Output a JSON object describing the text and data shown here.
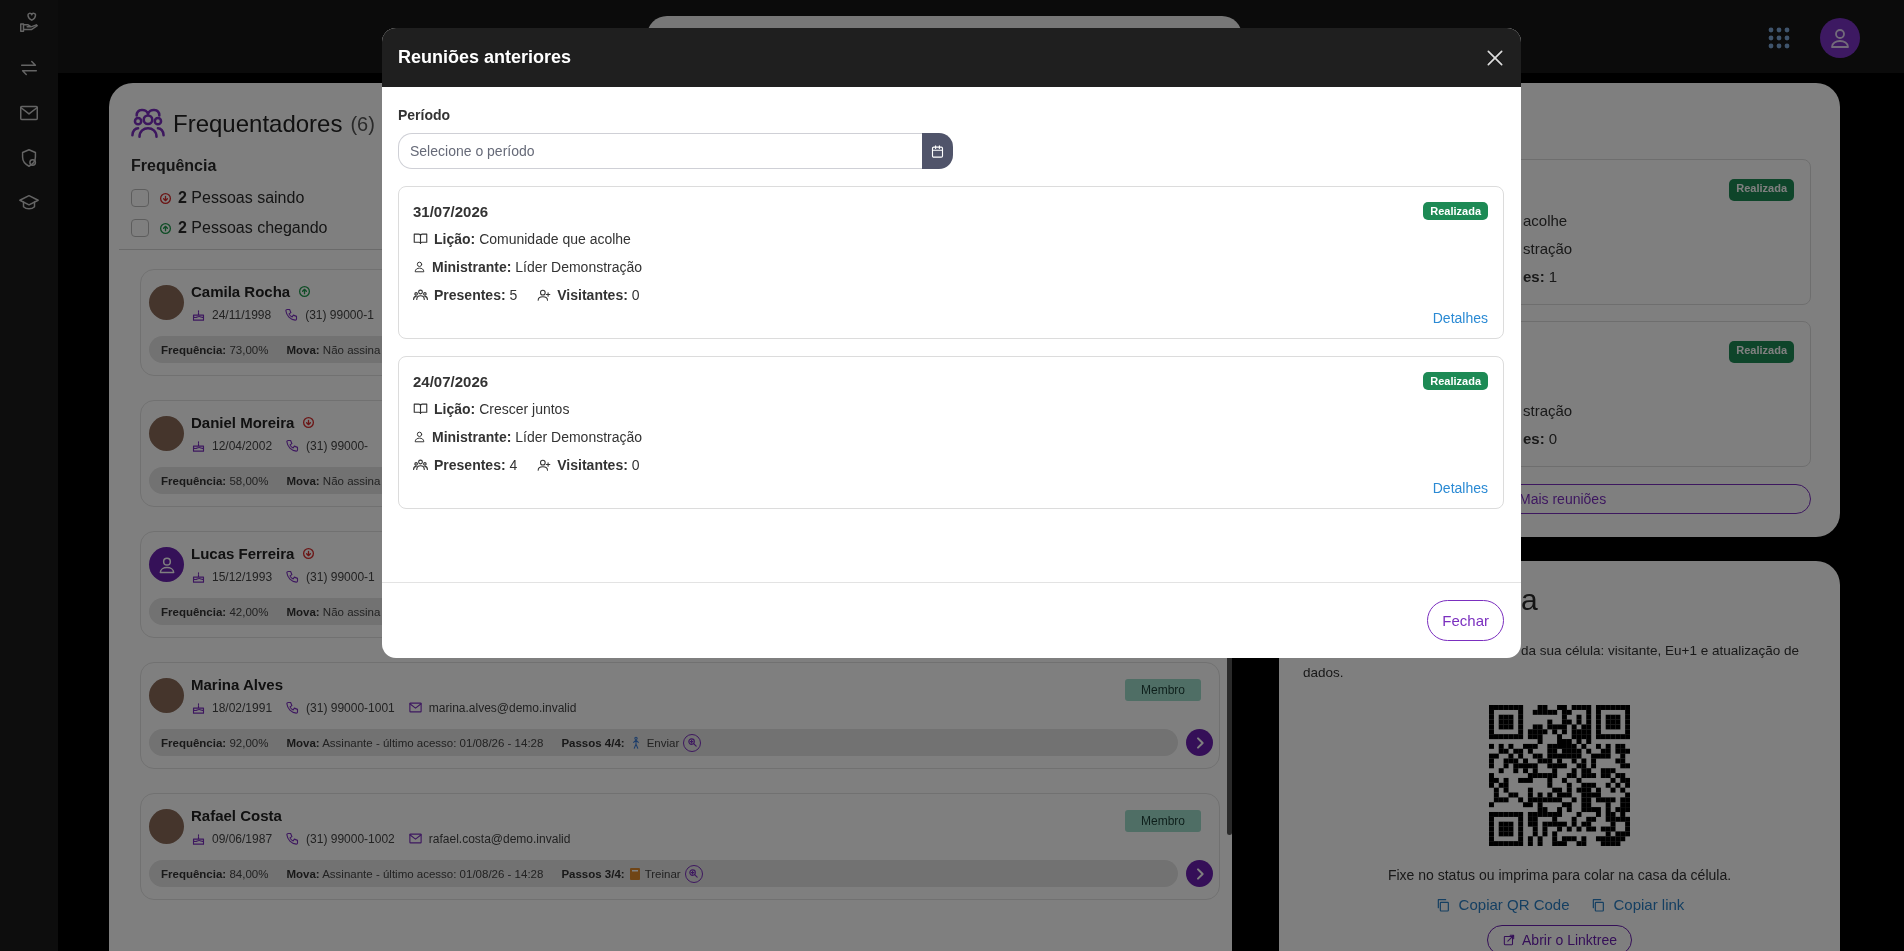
{
  "sidebar": {
    "items": [
      {
        "kind": "hand-heart"
      },
      {
        "kind": "swap"
      },
      {
        "kind": "mail"
      },
      {
        "kind": "shield"
      },
      {
        "kind": "cap"
      }
    ]
  },
  "attendees": {
    "title": "Frequentadores",
    "count": "(6)",
    "filter_title": "Frequência",
    "filters": [
      {
        "text": "**2** Pessoas saindo",
        "kind": "out",
        "checked": false
      },
      {
        "text": "**2** Pessoas chegando",
        "kind": "in",
        "checked": false
      }
    ],
    "people": [
      {
        "name": "Camila Rocha",
        "kind": "photo",
        "arriving": true,
        "leaving": false,
        "birthdate": "24/11/1998",
        "phone": "(31) 99000-1",
        "frequency": {
          "label": "Frequência:",
          "value": "73,00%"
        },
        "mova": {
          "label": "Mova:",
          "value": "Não assina"
        }
      },
      {
        "name": "Daniel Moreira",
        "kind": "photo",
        "arriving": false,
        "leaving": true,
        "birthdate": "12/04/2002",
        "phone": "(31) 99000-",
        "frequency": {
          "label": "Frequência:",
          "value": "58,00%"
        },
        "mova": {
          "label": "Mova:",
          "value": "Não assina"
        }
      },
      {
        "name": "Lucas Ferreira",
        "kind": "icon",
        "arriving": false,
        "leaving": true,
        "birthdate": "15/12/1993",
        "phone": "(31) 99000-1",
        "frequency": {
          "label": "Frequência:",
          "value": "42,00%"
        },
        "mova": {
          "label": "Mova:",
          "value": "Não assina"
        }
      },
      {
        "name": "Marina Alves",
        "kind": "photo",
        "arriving": false,
        "leaving": false,
        "birthdate": "18/02/1991",
        "phone": "(31) 99000-1001",
        "email": "marina.alves@demo.invalid",
        "badge": "Membro",
        "frequency": {
          "label": "Frequência:",
          "value": "92,00%"
        },
        "mova": {
          "label": "Mova:",
          "value": "Assinante - último acesso: 01/08/26 - 14:28"
        },
        "steps": {
          "label": "Passos 4/4:",
          "kind": "walk",
          "action": "Enviar"
        }
      },
      {
        "name": "Rafael Costa",
        "kind": "photo",
        "arriving": false,
        "leaving": false,
        "birthdate": "09/06/1987",
        "phone": "(31) 99000-1002",
        "email": "rafael.costa@demo.invalid",
        "badge": "Membro",
        "frequency": {
          "label": "Frequência:",
          "value": "84,00%"
        },
        "mova": {
          "label": "Mova:",
          "value": "Assinante - último acesso: 01/08/26 - 14:28"
        },
        "steps": {
          "label": "Passos 3/4:",
          "kind": "book",
          "action": "Treinar"
        }
      }
    ]
  },
  "meetings_panel": {
    "cards": [
      {
        "badge": "Realizada",
        "lesson": "acolhe",
        "minister": "stração",
        "counts": "**es:** 1"
      },
      {
        "badge": "Realizada",
        "minister": "stração",
        "counts": "**es:** 0"
      }
    ],
    "more_button": "Mais reuniões"
  },
  "link_panel": {
    "title": "a",
    "description": "da sua célula: visitante, Eu+1 e atualização de dados.",
    "caption": "Fixe no status ou imprima para colar na casa da célula.",
    "links": [
      "Copiar QR Code",
      "Copiar link"
    ],
    "open_button": "Abrir o Linktree"
  },
  "modal": {
    "title": "Reuniões anteriores",
    "period_label": "Período",
    "period_placeholder": "Selecione o período",
    "meetings": [
      {
        "date": "31/07/2026",
        "status": "Realizada",
        "lesson": {
          "label": "Lição:",
          "value": "Comunidade que acolhe"
        },
        "minister": {
          "label": "Ministrante:",
          "value": "Líder Demonstração"
        },
        "present": {
          "label": "Presentes:",
          "value": "5"
        },
        "visitors": {
          "label": "Visitantes:",
          "value": "0"
        },
        "details": "Detalhes"
      },
      {
        "date": "24/07/2026",
        "status": "Realizada",
        "lesson": {
          "label": "Lição:",
          "value": "Crescer juntos"
        },
        "minister": {
          "label": "Ministrante:",
          "value": "Líder Demonstração"
        },
        "present": {
          "label": "Presentes:",
          "value": "4"
        },
        "visitors": {
          "label": "Visitantes:",
          "value": "0"
        },
        "details": "Detalhes"
      }
    ],
    "close_button": "Fechar"
  }
}
